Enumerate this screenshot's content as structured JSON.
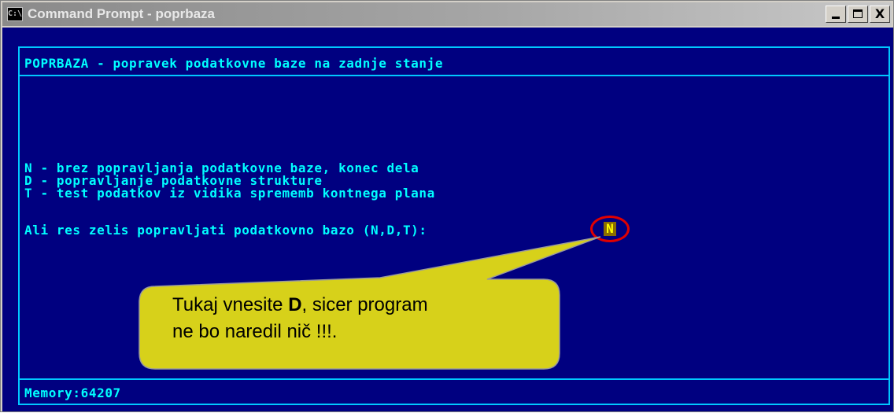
{
  "window": {
    "title": "Command Prompt - poprbaza",
    "icon": "console-icon",
    "icon_text": "C:\\",
    "buttons": {
      "minimize": "minimize-icon",
      "maximize": "maximize-icon",
      "close": "close-icon",
      "close_glyph": "X"
    }
  },
  "console": {
    "header": "POPRBAZA - popravek podatkovne baze na zadnje stanje",
    "options": [
      "N - brez popravljanja podatkovne baze, konec dela",
      "D - popravljanje podatkovne strukture",
      "T - test podatkov iz vidika sprememb kontnega plana"
    ],
    "prompt": "Ali res zelis popravljati podatkovno bazo (N,D,T):",
    "current_answer": "N",
    "status": "Memory:64207"
  },
  "callout": {
    "text_prefix": "Tukaj vnesite ",
    "text_bold": "D",
    "text_suffix": ", sicer program",
    "line2": "ne bo naredil nič !!!.",
    "fill_color": "#d7d11a",
    "ring_color": "#e00000"
  },
  "colors": {
    "console_bg": "#000080",
    "console_text": "#00ffff",
    "frame": "#00c8ff",
    "answer_fg": "#ffff00"
  }
}
